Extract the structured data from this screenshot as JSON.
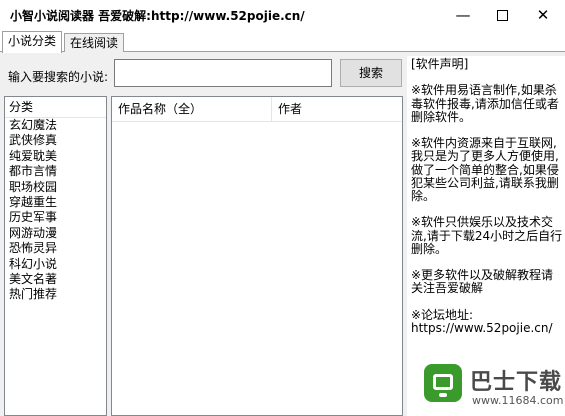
{
  "window": {
    "title": "小智小说阅读器  吾爱破解:http://www.52pojie.cn/",
    "controls": {
      "minimize": "—",
      "close": "✕"
    }
  },
  "tabs": [
    {
      "label": "小说分类",
      "active": true
    },
    {
      "label": "在线阅读",
      "active": false
    }
  ],
  "search": {
    "label": "输入要搜索的小说:",
    "value": "",
    "button": "搜索"
  },
  "categories": {
    "header": "分类",
    "items": [
      "玄幻魔法",
      "武侠修真",
      "纯爱耽美",
      "都市言情",
      "职场校园",
      "穿越重生",
      "历史军事",
      "网游动漫",
      "恐怖灵异",
      "科幻小说",
      "美文名著",
      "热门推荐"
    ]
  },
  "results": {
    "columns": [
      "作品名称（全）",
      "作者"
    ],
    "rows": []
  },
  "notice": {
    "text": "[软件声明]\n\n※软件用易语言制作,如果杀毒软件报毒,请添加信任或者删除软件。\n\n※软件内资源来自于互联网,我只是为了更多人方便使用,做了一个简单的整合,如果侵犯某些公司利益,请联系我删除。\n\n※软件只供娱乐以及技术交流,请于下载24小时之后自行删除。\n\n※更多软件以及破解教程请关注吾爱破解\n\n※论坛地址:\nhttps://www.52pojie.cn/"
  },
  "watermark": {
    "name": "巴士下载",
    "url": "www.11684.com",
    "brand_color": "#3a9a2c"
  }
}
